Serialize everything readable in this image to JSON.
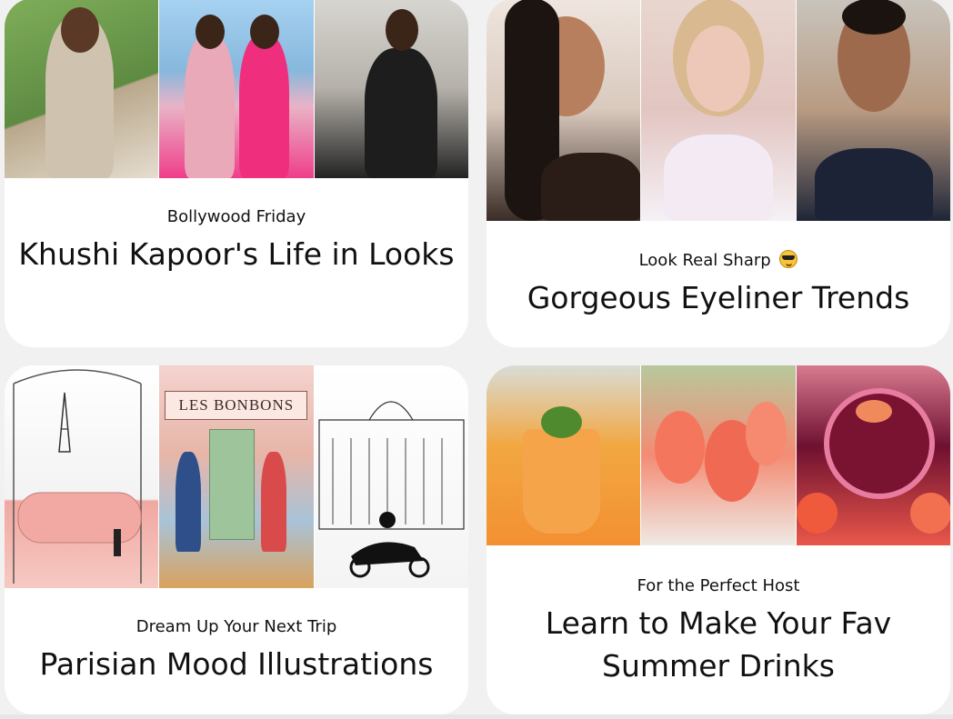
{
  "cards": [
    {
      "eyebrow": "Bollywood Friday",
      "title": "Khushi Kapoor's Life in Looks",
      "images": [
        "photo-outdoor-portrait",
        "photo-pink-dresses",
        "photo-black-corset"
      ]
    },
    {
      "eyebrow": "Look Real Sharp",
      "eyebrow_emoji": "sunglasses-emoji",
      "title": "Gorgeous Eyeliner Trends",
      "images": [
        "photo-braided-portrait",
        "photo-blonde-portrait",
        "photo-sleek-bun-portrait"
      ]
    },
    {
      "eyebrow": "Dream Up Your Next Trip",
      "title": "Parisian Mood Illustrations",
      "images": [
        "illustration-bathtub-eiffel",
        "illustration-les-bonbons-shop",
        "illustration-opera-scooter"
      ],
      "illustration_text": "LES BONBONS"
    },
    {
      "eyebrow": "For the Perfect Host",
      "title": "Learn to Make Your Fav Summer Drinks",
      "images": [
        "photo-passionfruit-drink",
        "photo-spritz-glasses",
        "photo-grapefruit-cocktail"
      ]
    }
  ]
}
